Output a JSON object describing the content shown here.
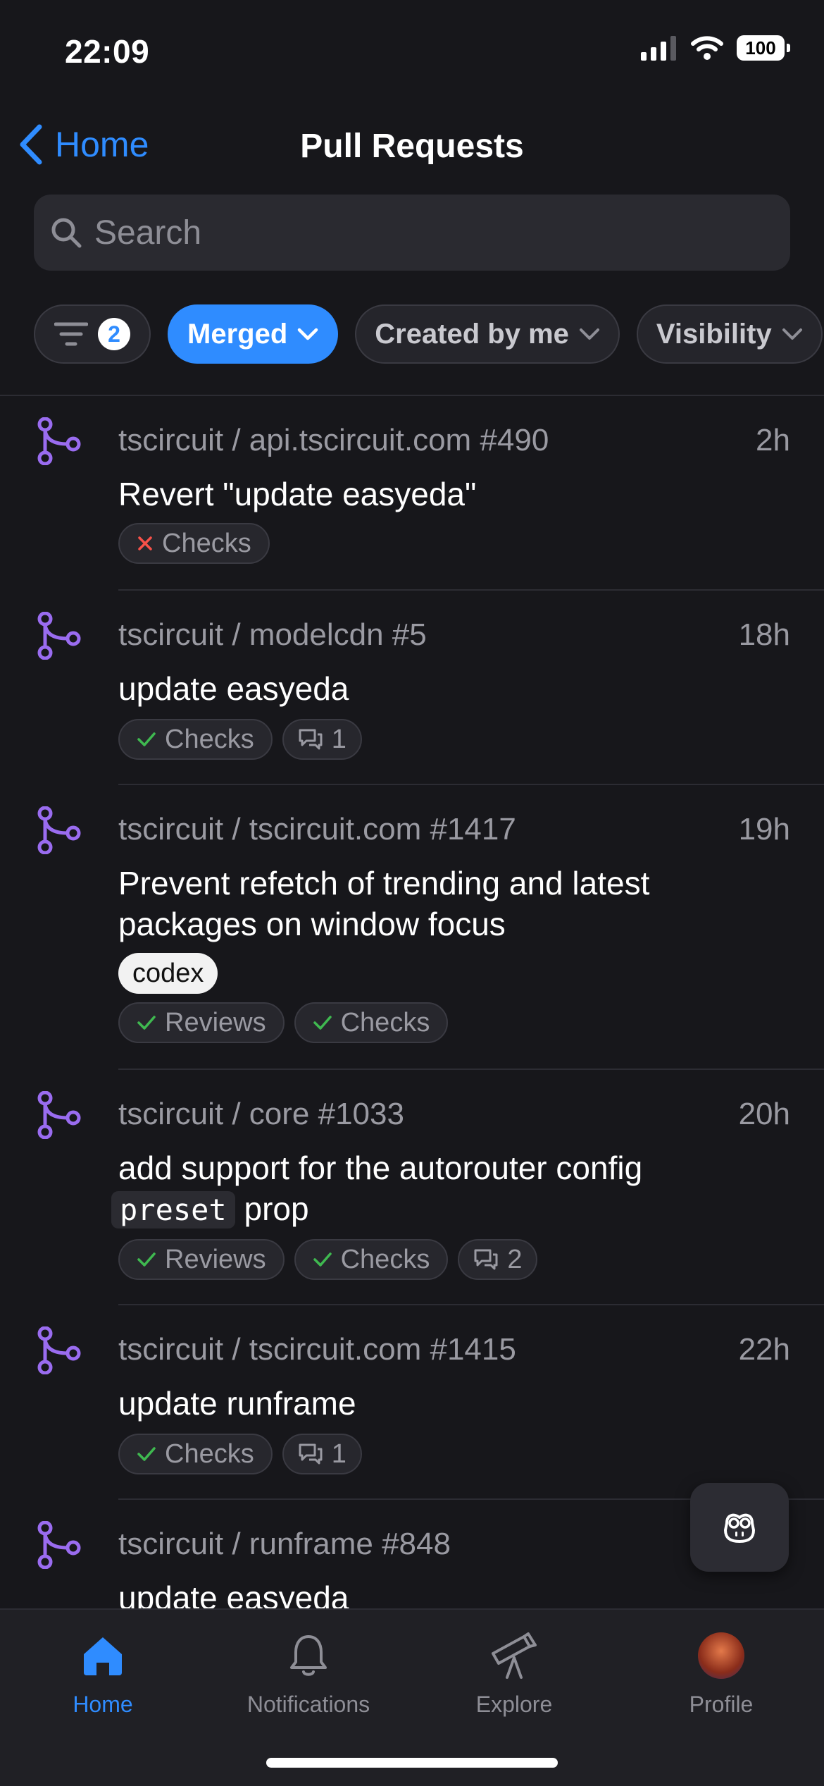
{
  "status_bar": {
    "time": "22:09",
    "battery": "100"
  },
  "nav": {
    "back_label": "Home",
    "title": "Pull Requests"
  },
  "search": {
    "placeholder": "Search"
  },
  "filters": {
    "active_count": "2",
    "chips": [
      "Merged",
      "Created by me",
      "Visibility"
    ]
  },
  "pull_requests": [
    {
      "repo": "tscircuit / api.tscircuit.com #490",
      "time": "2h",
      "title": "Revert \"update easyeda\"",
      "checks": {
        "label": "Checks",
        "status": "fail"
      }
    },
    {
      "repo": "tscircuit / modelcdn #5",
      "time": "18h",
      "title": "update easyeda",
      "checks": {
        "label": "Checks",
        "status": "pass"
      },
      "comments": "1"
    },
    {
      "repo": "tscircuit / tscircuit.com #1417",
      "time": "19h",
      "title": "Prevent refetch of trending and latest packages on window focus",
      "label": "codex",
      "reviews": "Reviews",
      "checks": {
        "label": "Checks",
        "status": "pass"
      }
    },
    {
      "repo": "tscircuit / core #1033",
      "time": "20h",
      "title_part1": "add support for the autorouter config",
      "title_code": "preset",
      "title_part2": "prop",
      "reviews": "Reviews",
      "checks": {
        "label": "Checks",
        "status": "pass"
      },
      "comments": "2"
    },
    {
      "repo": "tscircuit / tscircuit.com #1415",
      "time": "22h",
      "title": "update runframe",
      "checks": {
        "label": "Checks",
        "status": "pass"
      },
      "comments": "1"
    },
    {
      "repo": "tscircuit / runframe #848",
      "time": "",
      "title": "update easyeda"
    }
  ],
  "tabs": [
    {
      "label": "Home",
      "icon": "house-icon",
      "active": true
    },
    {
      "label": "Notifications",
      "icon": "bell-icon",
      "active": false
    },
    {
      "label": "Explore",
      "icon": "telescope-icon",
      "active": false
    },
    {
      "label": "Profile",
      "icon": "avatar",
      "active": false
    }
  ],
  "colors": {
    "accent": "#2f8cff",
    "merged": "#9a6cf0",
    "pass": "#3fb950",
    "fail": "#f85149",
    "background": "#17171b"
  }
}
